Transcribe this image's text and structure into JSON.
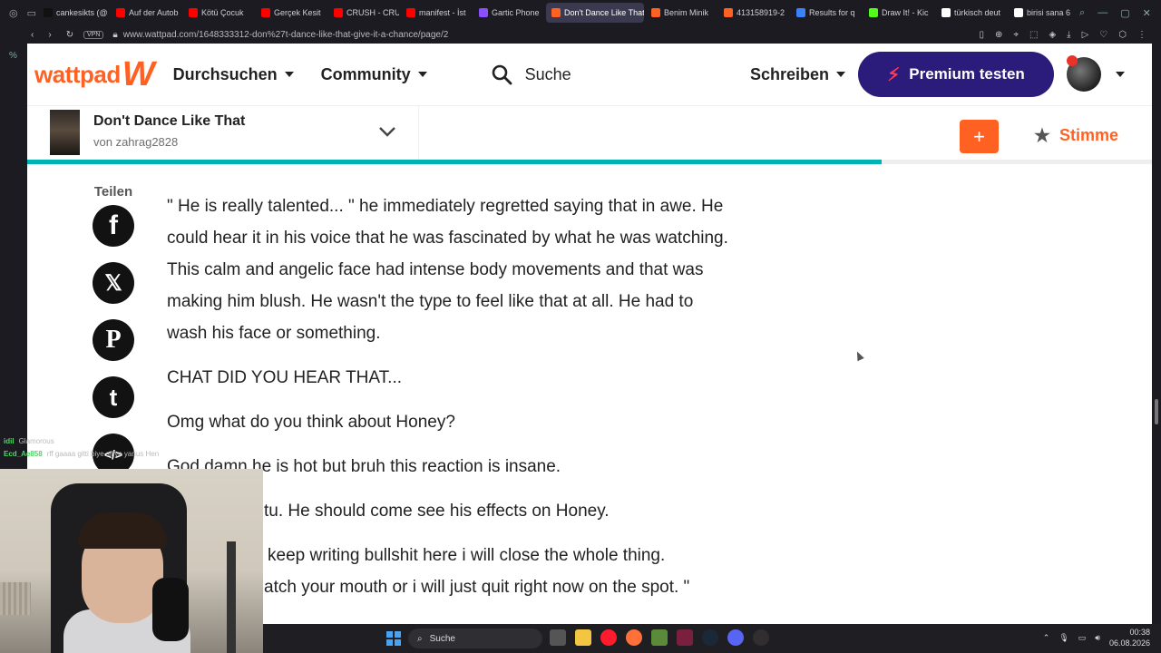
{
  "browser": {
    "tabs": [
      {
        "label": "cankesikts (@",
        "color": "#111111"
      },
      {
        "label": "Auf der Autob",
        "color": "#ff0000"
      },
      {
        "label": "Kötü Çocuk",
        "color": "#ff0000"
      },
      {
        "label": "Gerçek Kesit",
        "color": "#ff0000"
      },
      {
        "label": "CRUSH - CRU",
        "color": "#ff0000"
      },
      {
        "label": "manifest - İst",
        "color": "#ff0000"
      },
      {
        "label": "Gartic Phone",
        "color": "#8a4fff"
      },
      {
        "label": "Don't Dance Like That",
        "color": "#ff6122",
        "active": true
      },
      {
        "label": "Benim Minik",
        "color": "#ff6122"
      },
      {
        "label": "413158919-2",
        "color": "#ff6122"
      },
      {
        "label": "Results for q",
        "color": "#3b82f6"
      },
      {
        "label": "Draw It! - Kic",
        "color": "#53fc18"
      },
      {
        "label": "türkisch deut",
        "color": "#ffffff"
      },
      {
        "label": "birisi sana 6",
        "color": "#ffffff"
      }
    ],
    "vpn_label": "VPN",
    "url": "www.wattpad.com/1648333312-don%27t-dance-like-that-give-it-a-chance/page/2"
  },
  "header": {
    "logo_text": "wattpad",
    "logo_mark": "W",
    "browse_label": "Durchsuchen",
    "community_label": "Community",
    "search_label": "Suche",
    "write_label": "Schreiben",
    "premium_label": "Premium testen",
    "brand_color": "#ff6122",
    "premium_color": "#2b1b7a"
  },
  "story": {
    "title": "Don't Dance Like That",
    "author": "von zahrag2828",
    "vote_label": "Stimme",
    "add_label": "+",
    "reading_progress": 0.76,
    "progress_color": "#00b2b2"
  },
  "share": {
    "label": "Teilen",
    "networks": [
      "facebook-icon",
      "x-icon",
      "pinterest-icon",
      "tumblr-icon",
      "embed-icon"
    ]
  },
  "text": {
    "p1": "\" He is really talented... \" he immediately regretted saying that in awe. He could hear it in his voice that he was fascinated by what he was watching. This calm and angelic face had intense body movements and that was making him blush. He wasn't the type to feel like that at all. He had to wash his face or something.",
    "p2": "CHAT DID YOU HEAR THAT...",
    "p3": "Omg what do you think about Honey?",
    "p4": "God damn he is hot but bruh this reaction is insane.",
    "p5": "tu. He should come see his effects on Honey.",
    "p6": "keep writing bullshit here i will close the whole thing.",
    "p7": "atch your mouth or i will just quit right now on the spot. \""
  },
  "chat": [
    {
      "user": "idil",
      "msg": "Glamorous"
    },
    {
      "user": "Ecd_Ae858",
      "msg": "rff gaaaa gitti biye siliye yanus Hen"
    }
  ],
  "taskbar": {
    "search_label": "Suche",
    "time": "00:38",
    "date": "06.08.2026"
  }
}
